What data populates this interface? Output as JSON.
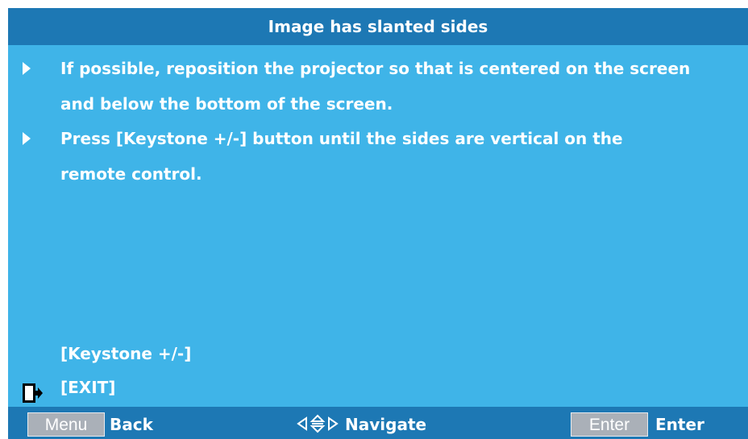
{
  "title": "Image has slanted sides",
  "instructions": [
    {
      "line1": "If possible, reposition the projector so that is centered on the screen",
      "line2": "and below the bottom of the screen."
    },
    {
      "line1": "Press [Keystone +/-] button until the sides are vertical on the",
      "line2": "remote control."
    }
  ],
  "keystone_label": "[Keystone +/-]",
  "exit_label": "[EXIT]",
  "footer": {
    "menu_key": "Menu",
    "back_label": "Back",
    "navigate_label": "Navigate",
    "enter_key": "Enter",
    "enter_label": "Enter"
  },
  "colors": {
    "background": "#3fb4e8",
    "bars": "#1d78b4",
    "key_box": "#aab0b8",
    "text": "#ffffff"
  },
  "icons": [
    "arrow-bullet-icon",
    "exit-icon",
    "navigate-arrows-icon"
  ]
}
